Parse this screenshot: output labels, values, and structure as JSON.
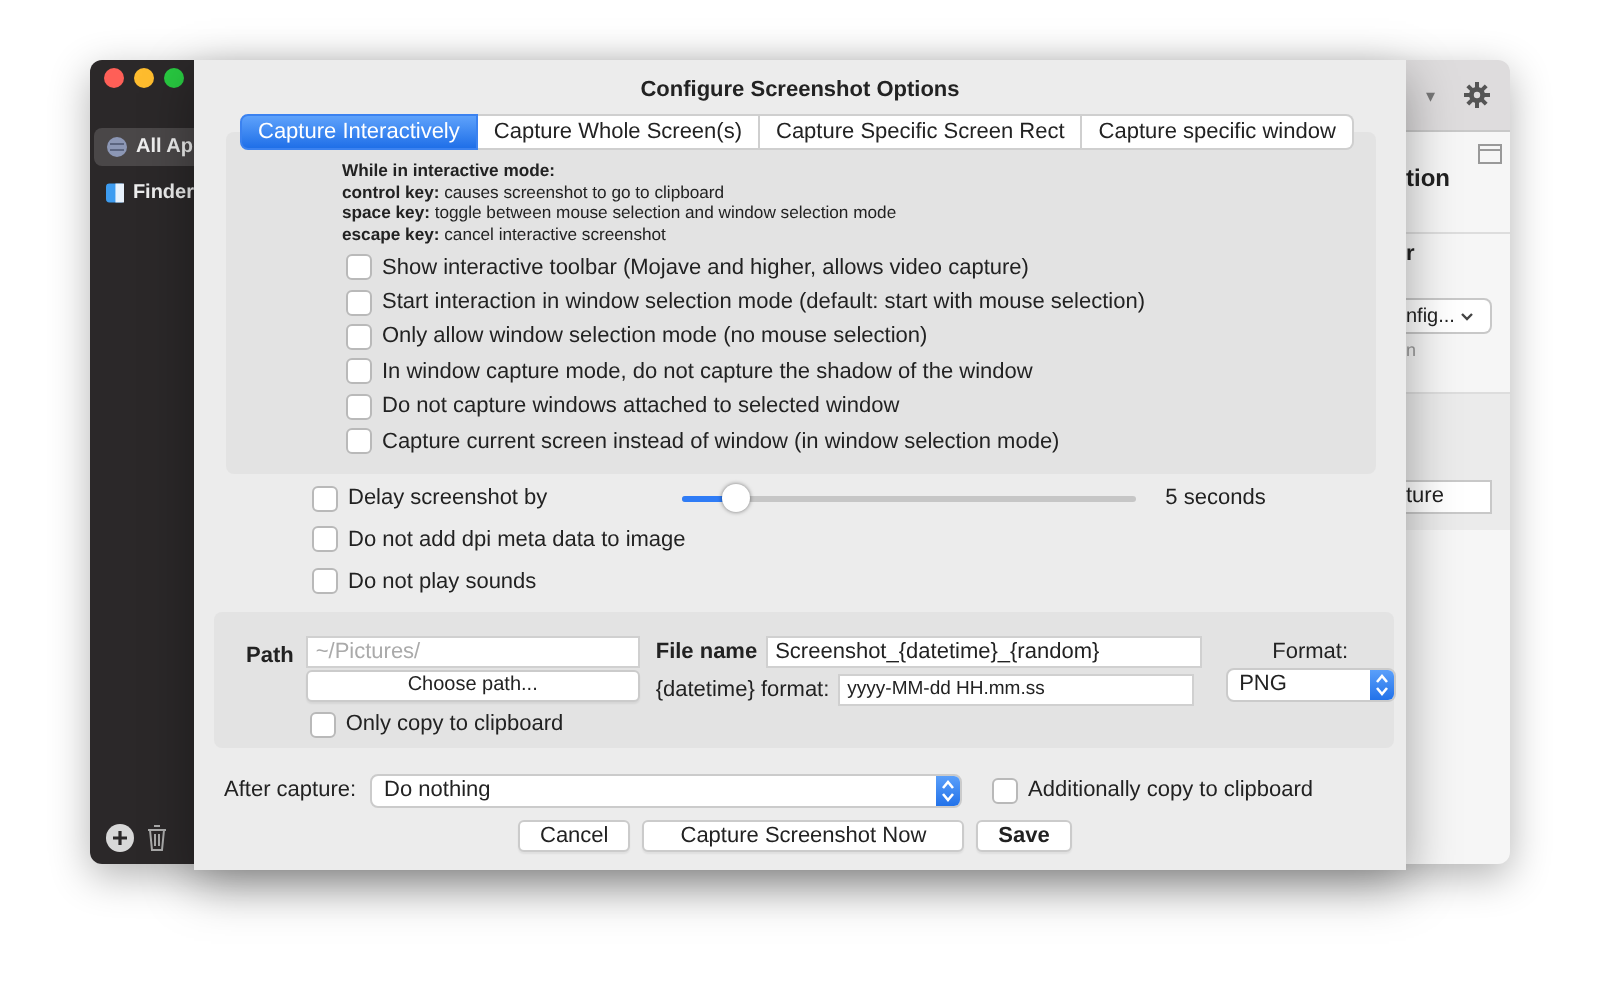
{
  "background_window": {
    "sidebar": {
      "items": [
        {
          "label": "All Ap",
          "selected": true,
          "kind": "globe"
        },
        {
          "label": "Finder",
          "selected": false,
          "kind": "finder"
        }
      ]
    },
    "right_strip": {
      "header_caret": "▾",
      "heading": "tion",
      "subheading": "r",
      "dropdown": "nfig...",
      "hint": "n",
      "field": "ture"
    }
  },
  "dialog": {
    "title": "Configure Screenshot Options",
    "tabs": [
      {
        "label": "Capture Interactively",
        "selected": true
      },
      {
        "label": "Capture Whole Screen(s)",
        "selected": false
      },
      {
        "label": "Capture Specific Screen Rect",
        "selected": false
      },
      {
        "label": "Capture specific window",
        "selected": false
      }
    ],
    "info_heading": "While in interactive mode:",
    "info_lines": [
      "**control key:** causes screenshot to go to clipboard",
      "**space key:** toggle between mouse selection and window selection mode",
      "**escape key:** cancel interactive screenshot"
    ],
    "tab_options": [
      {
        "label": "Show interactive toolbar (Mojave and higher, allows video capture)",
        "checked": false
      },
      {
        "label": "Start interaction in window selection mode (default: start with mouse selection)",
        "checked": false
      },
      {
        "label": "Only allow window selection mode (no mouse selection)",
        "checked": false
      },
      {
        "label": "In window capture mode, do not capture the shadow of the window",
        "checked": false
      },
      {
        "label": "Do not capture windows attached to selected window",
        "checked": false
      },
      {
        "label": "Capture current screen instead of window (in window selection mode)",
        "checked": false
      }
    ],
    "delay": {
      "label": "Delay screenshot by",
      "checked": false,
      "level": 0.12,
      "reading": "5 seconds"
    },
    "options": [
      {
        "label": "Do not add dpi meta data to image",
        "checked": false
      },
      {
        "label": "Do not play sounds",
        "checked": false
      }
    ],
    "path": {
      "label": "Path",
      "placeholder": "~/Pictures/",
      "choose_button": "Choose path...",
      "only_clipboard": {
        "label": "Only copy to clipboard",
        "checked": false
      }
    },
    "file_name": {
      "label": "File name",
      "value": "Screenshot_{datetime}_{random}",
      "format_label": "{datetime} format:",
      "format_value": "yyyy-MM-dd HH.mm.ss"
    },
    "format": {
      "label": "Format:",
      "value": "PNG"
    },
    "after_capture": {
      "label": "After capture:",
      "value": "Do nothing",
      "additionally": {
        "label": "Additionally copy to clipboard",
        "checked": false
      }
    },
    "buttons": [
      "Cancel",
      "Capture Screenshot Now",
      "Save"
    ]
  }
}
